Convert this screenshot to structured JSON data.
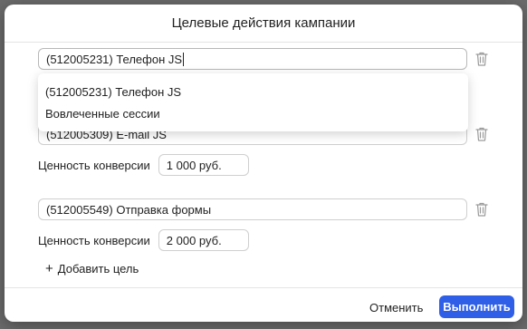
{
  "dialog": {
    "title": "Целевые действия кампании",
    "goals": [
      {
        "name": "(512005231) Телефон JS",
        "focused": true
      },
      {
        "name": "(512005309) E-mail JS",
        "value": "1 000 руб."
      },
      {
        "name": "(512005549) Отправка формы",
        "value": "2 000 руб."
      }
    ],
    "value_label": "Ценность конверсии",
    "dropdown": {
      "options": [
        "(512005231) Телефон JS",
        "Вовлеченные сессии"
      ]
    },
    "add_goal_label": "Добавить цель",
    "add_icon": "plus-icon",
    "delete_icon": "trash-icon",
    "footer": {
      "cancel_label": "Отменить",
      "run_label": "Выполнить"
    }
  },
  "colors": {
    "primary_button": "#2e5fe6",
    "backdrop": "#6b6b6b"
  }
}
